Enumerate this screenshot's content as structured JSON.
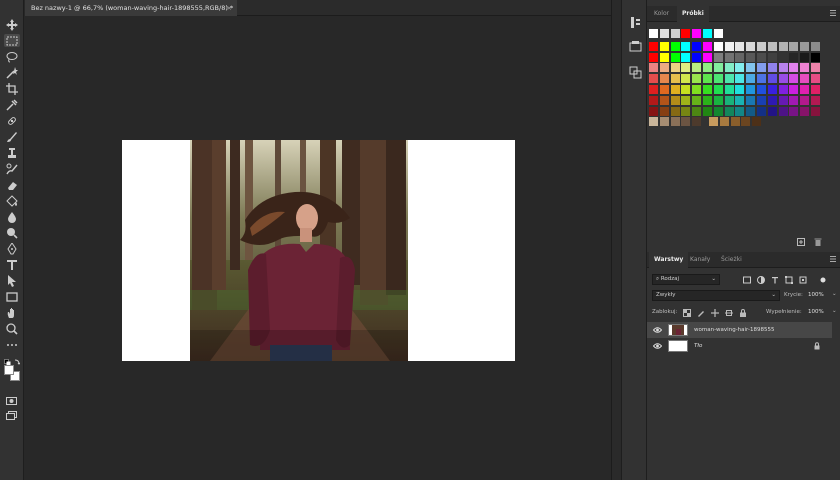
{
  "document_tab": {
    "title": "Bez nazwy-1 @ 66,7% (woman-waving-hair-1898555,RGB/8) *",
    "close": "×"
  },
  "toolbar": {
    "tools": [
      {
        "name": "move-tool-icon"
      },
      {
        "name": "marquee-tool-icon"
      },
      {
        "name": "lasso-tool-icon"
      },
      {
        "name": "magic-wand-tool-icon"
      },
      {
        "name": "crop-tool-icon"
      },
      {
        "name": "eyedropper-tool-icon"
      },
      {
        "name": "healing-brush-tool-icon"
      },
      {
        "name": "brush-tool-icon"
      },
      {
        "name": "clone-stamp-tool-icon"
      },
      {
        "name": "history-brush-tool-icon"
      },
      {
        "name": "eraser-tool-icon"
      },
      {
        "name": "paint-bucket-tool-icon"
      },
      {
        "name": "blur-tool-icon"
      },
      {
        "name": "dodge-tool-icon"
      },
      {
        "name": "pen-tool-icon"
      },
      {
        "name": "type-tool-icon"
      },
      {
        "name": "path-selection-tool-icon"
      },
      {
        "name": "rectangle-tool-icon"
      },
      {
        "name": "hand-tool-icon"
      },
      {
        "name": "zoom-tool-icon"
      },
      {
        "name": "more-tools-icon"
      }
    ],
    "foreground_color": "#ffffff",
    "background_color": "#ffffff"
  },
  "color_panel": {
    "tabs": [
      "Kolor",
      "Próbki"
    ],
    "active_tab": "Próbki"
  },
  "layers_panel": {
    "tabs": [
      "Warstwy",
      "Kanały",
      "Ścieżki"
    ],
    "active_tab": "Warstwy",
    "filter_label": "Rodzaj",
    "blend_mode": "Zwykły",
    "opacity_label": "Krycie:",
    "opacity_value": "100%",
    "lock_label": "Zablokuj:",
    "fill_label": "Wypełnienie:",
    "fill_value": "100%",
    "layers": [
      {
        "name": "woman-waving-hair-1898555",
        "selected": true,
        "visible": true,
        "locked": false
      },
      {
        "name": "Tło",
        "selected": false,
        "visible": true,
        "locked": true
      }
    ]
  },
  "colors": {
    "accent": "#ffffff",
    "panel_bg": "#323232",
    "canvas_bg": "#282828",
    "sweater": "#6b2335"
  }
}
